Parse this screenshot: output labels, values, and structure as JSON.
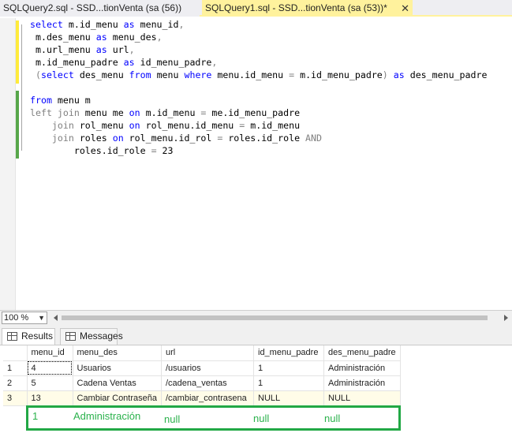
{
  "tabs": [
    {
      "label": "SQLQuery2.sql - SSD...tionVenta (sa (56))",
      "active": false
    },
    {
      "label": "SQLQuery1.sql - SSD...tionVenta (sa (53))*",
      "active": true
    }
  ],
  "tab_close_glyph": "✕",
  "colors": {
    "active_tab": "#fff29d",
    "keyword": "#0000ff",
    "function": "#ff00ff",
    "annotation": "#22a845"
  },
  "editor": {
    "lines": [
      [
        {
          "t": "select",
          "c": "kw"
        },
        {
          "t": " m.id_menu "
        },
        {
          "t": "as",
          "c": "kw"
        },
        {
          "t": " menu_id"
        },
        {
          "t": ",",
          "c": "op"
        }
      ],
      [
        {
          "t": " m.des_menu "
        },
        {
          "t": "as",
          "c": "kw"
        },
        {
          "t": " menu_des"
        },
        {
          "t": ",",
          "c": "op"
        }
      ],
      [
        {
          "t": " m.url_menu "
        },
        {
          "t": "as",
          "c": "kw"
        },
        {
          "t": " url"
        },
        {
          "t": ",",
          "c": "op"
        }
      ],
      [
        {
          "t": " m.id_menu_padre "
        },
        {
          "t": "as",
          "c": "kw"
        },
        {
          "t": " id_menu_padre"
        },
        {
          "t": ",",
          "c": "op"
        }
      ],
      [
        {
          "t": " "
        },
        {
          "t": "(",
          "c": "op"
        },
        {
          "t": "select",
          "c": "kw"
        },
        {
          "t": " des_menu "
        },
        {
          "t": "from",
          "c": "kw"
        },
        {
          "t": " menu "
        },
        {
          "t": "where",
          "c": "kw"
        },
        {
          "t": " menu.id_menu "
        },
        {
          "t": "=",
          "c": "op"
        },
        {
          "t": " m.id_menu_padre"
        },
        {
          "t": ")",
          "c": "op"
        },
        {
          "t": " "
        },
        {
          "t": "as",
          "c": "kw"
        },
        {
          "t": " des_menu_padre"
        }
      ],
      [],
      [
        {
          "t": "from",
          "c": "kw"
        },
        {
          "t": " menu m"
        }
      ],
      [
        {
          "t": "left join",
          "c": "op"
        },
        {
          "t": " menu me "
        },
        {
          "t": "on",
          "c": "kw"
        },
        {
          "t": " m.id_menu "
        },
        {
          "t": "=",
          "c": "op"
        },
        {
          "t": " me.id_menu_padre"
        }
      ],
      [
        {
          "t": "    "
        },
        {
          "t": "join",
          "c": "op"
        },
        {
          "t": " rol_menu "
        },
        {
          "t": "on",
          "c": "kw"
        },
        {
          "t": " rol_menu.id_menu "
        },
        {
          "t": "=",
          "c": "op"
        },
        {
          "t": " m.id_menu"
        }
      ],
      [
        {
          "t": "    "
        },
        {
          "t": "join",
          "c": "op"
        },
        {
          "t": " roles "
        },
        {
          "t": "on",
          "c": "kw"
        },
        {
          "t": " rol_menu.id_rol "
        },
        {
          "t": "=",
          "c": "op"
        },
        {
          "t": " roles.id_role "
        },
        {
          "t": "AND",
          "c": "op"
        }
      ],
      [
        {
          "t": "        roles.id_role "
        },
        {
          "t": "=",
          "c": "op"
        },
        {
          "t": " 23"
        }
      ]
    ]
  },
  "zoom": {
    "value": "100 %"
  },
  "result_tabs": {
    "results": "Results",
    "messages": "Messages"
  },
  "grid": {
    "columns": [
      "menu_id",
      "menu_des",
      "url",
      "id_menu_padre",
      "des_menu_padre"
    ],
    "rows": [
      {
        "n": "1",
        "cells": [
          "4",
          "Usuarios",
          "/usuarios",
          "1",
          "Administración"
        ]
      },
      {
        "n": "2",
        "cells": [
          "5",
          "Cadena Ventas",
          "/cadena_ventas",
          "1",
          "Administración"
        ]
      },
      {
        "n": "3",
        "cells": [
          "13",
          "Cambiar Contraseña",
          "/cambiar_contrasena",
          "NULL",
          "NULL"
        ]
      }
    ]
  },
  "annotation": {
    "values": [
      "1",
      "Administración",
      "null",
      "null",
      "null"
    ]
  }
}
